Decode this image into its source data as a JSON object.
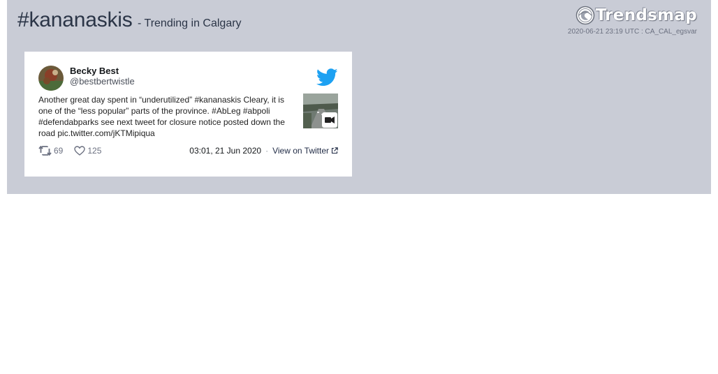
{
  "header": {
    "hashtag": "#kananaskis",
    "subtitle": "- Trending in Calgary",
    "brand": "Trendsmap",
    "meta": "2020-06-21 23:19 UTC : CA_CAL_egsvar"
  },
  "tweet": {
    "author_name": "Becky Best",
    "author_handle": "@bestbertwistle",
    "text": "Another great day spent in “underutilized” #kananaskis Cleary, it is one of the “less popular” parts of the province. #AbLeg #abpoli #defendabparks see next tweet for closure notice posted down the road pic.twitter.com/jKTMipiqua",
    "retweets": "69",
    "likes": "125",
    "timestamp": "03:01, 21 Jun 2020",
    "separator": "·",
    "view_link": "View on Twitter",
    "icons": {
      "bird": "twitter-bird-icon",
      "retweet": "retweet-icon",
      "like": "heart-icon",
      "video": "video-camera-icon",
      "external": "external-link-icon"
    },
    "colors": {
      "twitter_blue": "#1da1f2"
    }
  },
  "colors": {
    "panel_bg": "#c9ccd6",
    "title": "#2b3547"
  }
}
